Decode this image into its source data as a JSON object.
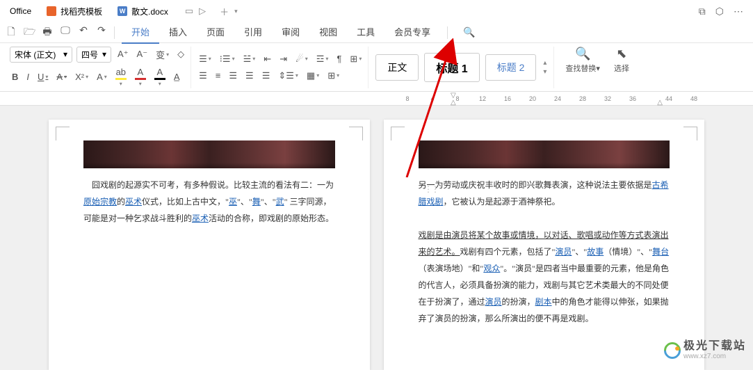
{
  "titlebar": {
    "tab1_label": "Office",
    "tab2_label": "找稻壳模板",
    "tab3_label": "散文.docx",
    "tab3_icon": "W"
  },
  "menu": {
    "tabs": [
      "开始",
      "插入",
      "页面",
      "引用",
      "审阅",
      "视图",
      "工具",
      "会员专享"
    ],
    "active_index": 0
  },
  "toolbar": {
    "font_name": "宋体 (正文)",
    "font_size": "四号",
    "styles": {
      "body": "正文",
      "h1": "标题 1",
      "h2": "标题 2"
    },
    "search_replace": "查找替换",
    "select": "选择"
  },
  "ruler": {
    "values": [
      "8",
      "4",
      "8",
      "12",
      "16",
      "20",
      "24",
      "28",
      "32",
      "36",
      "44",
      "48"
    ]
  },
  "document": {
    "left_page": {
      "para1_prefix": "囧戏剧的起源实不可考，有多种假说。比较主流的看法有二：一为",
      "link1": "原始宗教",
      "mid1": "的",
      "link2": "巫术",
      "mid2": "仪式，比如上古中文，\"",
      "link3": "巫",
      "mid3": "\"、\"",
      "link4": "舞",
      "mid4": "\"、\"",
      "link5": "武",
      "mid5": "\" 三字同源，可能是对一种乞求战斗胜利的",
      "link6": "巫术",
      "suffix": "活动的合称，即戏剧的原始形态。"
    },
    "right_page": {
      "para1_prefix": "另一为劳动或庆祝丰收时的即兴歌舞表演，这种说法主要依据是",
      "link1": "古希腊戏剧",
      "para1_suffix": "，它被认为是起源于酒神祭祀。",
      "para2_u": "戏剧是由演员将某个故事或情境，以对话、歌唱或动作等方式表演出来的艺术。",
      "para2_mid": "戏剧有四个元素，包括了\"",
      "link2": "演员",
      "para2_mid2": "\"、\"",
      "link3": "故事",
      "para2_mid3": "（情境）\"、\"",
      "link4": "舞台",
      "para2_mid4": "（表演场地）\"和\"",
      "link5": "观众",
      "para2_mid5": "\"。\"演员\"是四者当中最重要的元素，他是角色的代言人，必须具备扮演的能力，戏剧与其它艺术类最大的不同处便在于扮演了，通过",
      "link6": "演员",
      "para2_mid6": "的扮演，",
      "link7": "剧本",
      "para2_suffix": "中的角色才能得以伸张，如果抛弃了演员的扮演，那么所演出的便不再是戏剧。"
    }
  },
  "watermark": {
    "main": "极光下载站",
    "sub": "www.xz7.com"
  }
}
